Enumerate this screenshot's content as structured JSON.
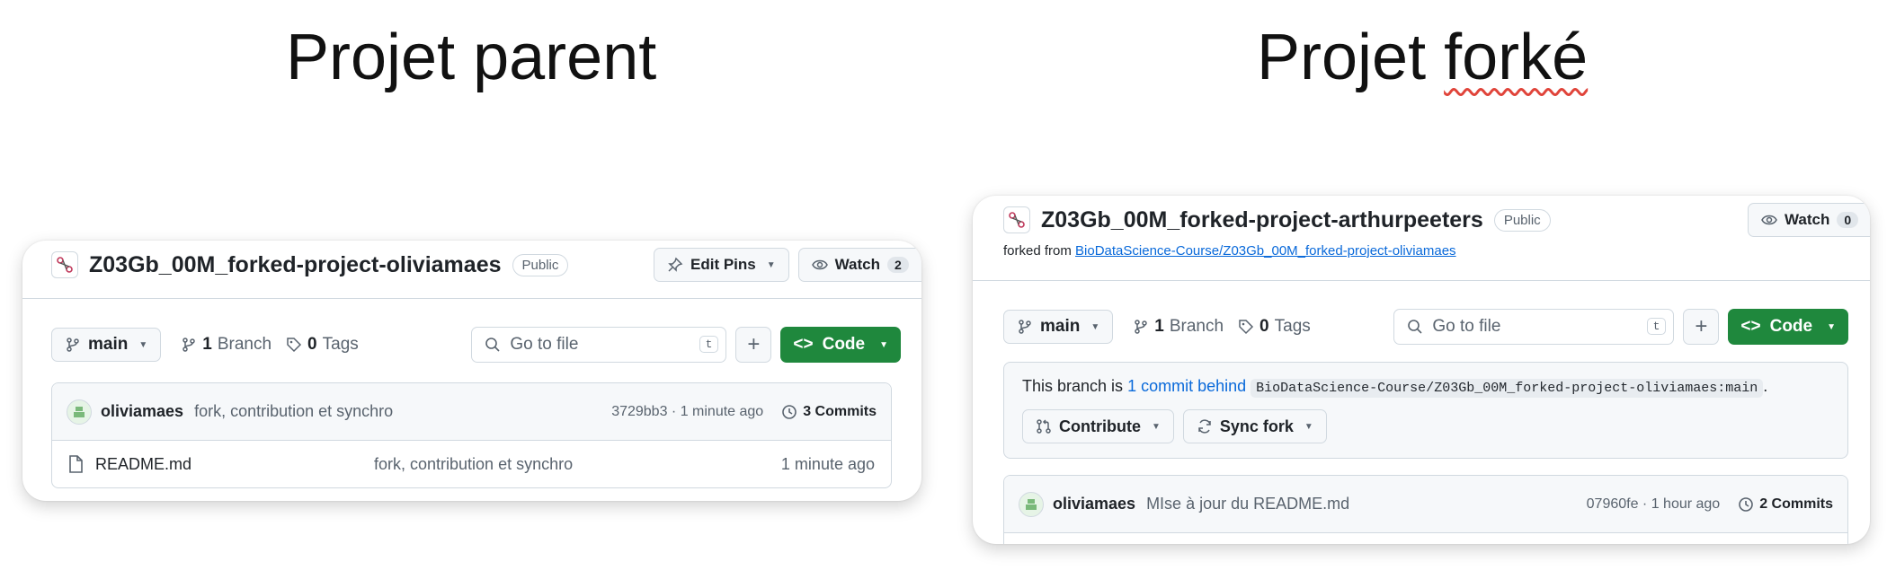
{
  "headings": {
    "left": "Projet parent",
    "right_part1": "Projet ",
    "right_part2": "forké"
  },
  "parent": {
    "repo_name": "Z03Gb_00M_forked-project-oliviamaes",
    "badge": "Public",
    "edit_pins": "Edit Pins",
    "watch_label": "Watch",
    "watch_count": "2",
    "branch": "main",
    "branch_count": "1",
    "branch_label": "Branch",
    "tags_count": "0",
    "tags_label": "Tags",
    "search_placeholder": "Go to file",
    "search_key": "t",
    "code_label": "Code",
    "commit": {
      "author": "oliviamaes",
      "message": "fork, contribution et synchro",
      "meta": "3729bb3 · 1 minute ago",
      "commits": "3 Commits"
    },
    "files": [
      {
        "name": "README.md",
        "message": "fork, contribution et synchro",
        "time": "1 minute ago"
      }
    ]
  },
  "fork": {
    "repo_name": "Z03Gb_00M_forked-project-arthurpeeters",
    "badge": "Public",
    "watch_label": "Watch",
    "watch_count": "0",
    "forked_from_label": "forked from",
    "forked_from_link": "BioDataScience-Course/Z03Gb_00M_forked-project-oliviamaes",
    "branch": "main",
    "branch_count": "1",
    "branch_label": "Branch",
    "tags_count": "0",
    "tags_label": "Tags",
    "search_placeholder": "Go to file",
    "search_key": "t",
    "code_label": "Code",
    "behind": {
      "prefix": "This branch is",
      "link": "1 commit behind",
      "ref": "BioDataScience-Course/Z03Gb_00M_forked-project-oliviamaes:main",
      "suffix": "."
    },
    "contribute_label": "Contribute",
    "sync_label": "Sync fork",
    "commit": {
      "author": "oliviamaes",
      "message": "MIse à jour du README.md",
      "meta": "07960fe · 1 hour ago",
      "commits": "2 Commits"
    }
  }
}
